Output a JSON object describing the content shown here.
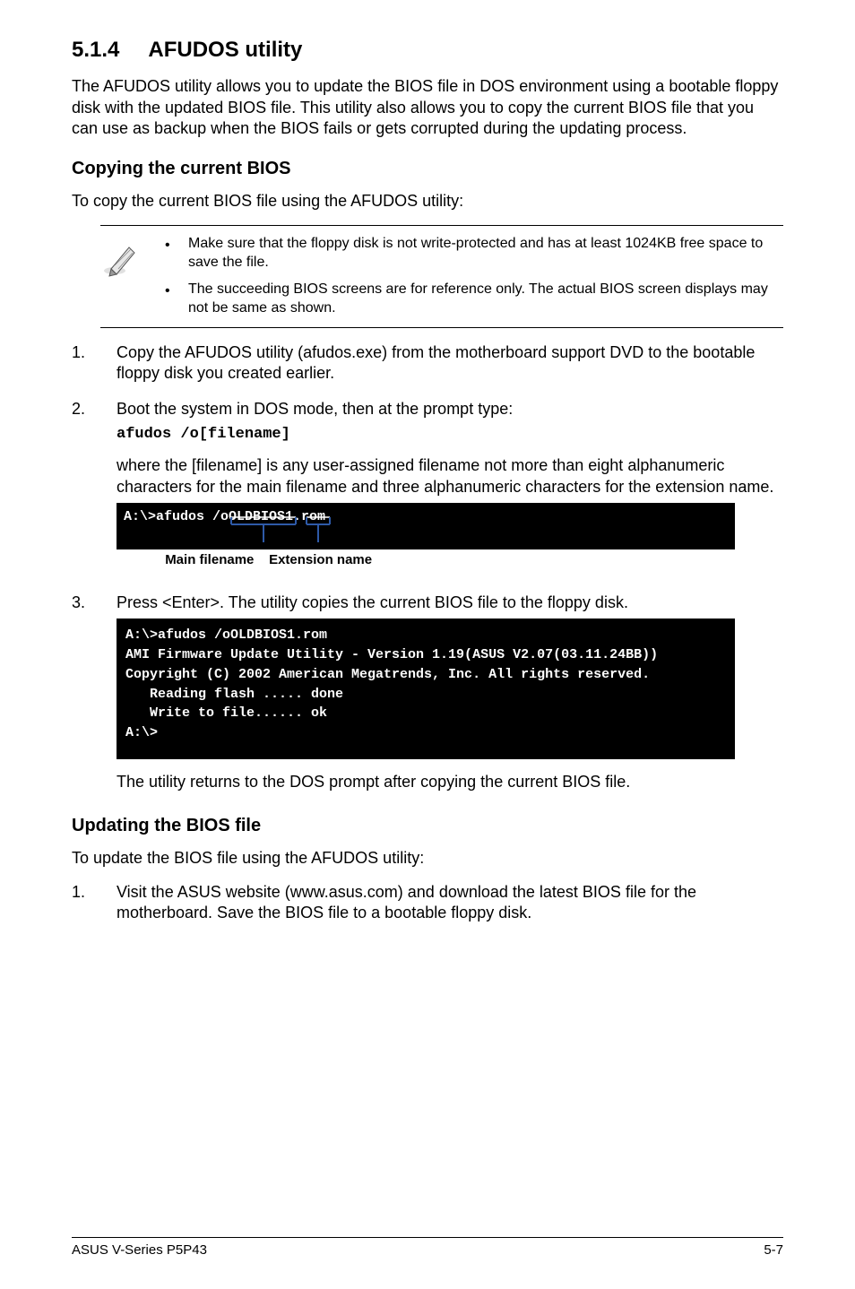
{
  "section": {
    "number": "5.1.4",
    "title": "AFUDOS utility"
  },
  "intro": "The AFUDOS utility allows you to update the BIOS file in DOS environment using a bootable floppy disk with the updated BIOS file. This utility also allows you to copy the current BIOS file that you can use as backup when the BIOS fails or gets corrupted during the updating process.",
  "copying": {
    "heading": "Copying the current BIOS",
    "lead": "To copy the current BIOS file using the AFUDOS utility:",
    "notes": [
      "Make sure that the floppy disk is not write-protected and has at least 1024KB free space to save the file.",
      "The succeeding BIOS screens are for reference only. The actual BIOS screen displays may not be same as shown."
    ]
  },
  "step1": "Copy the AFUDOS utility (afudos.exe) from the motherboard support DVD to the bootable floppy disk you created earlier.",
  "step2_lead": "Boot the system in DOS mode, then at the prompt type:",
  "step2_code": "afudos /o[filename]",
  "step2_desc": "where the [filename] is any user-assigned filename not more than eight alphanumeric characters  for the main filename and three alphanumeric characters for the extension name.",
  "term1_line": "A:\\>afudos /oOLDBIOS1.rom",
  "anno_main": "Main filename",
  "anno_ext": "Extension name",
  "step3": "Press <Enter>. The utility copies the current BIOS file to the floppy disk.",
  "term2": "A:\\>afudos /oOLDBIOS1.rom\nAMI Firmware Update Utility - Version 1.19(ASUS V2.07(03.11.24BB))\nCopyright (C) 2002 American Megatrends, Inc. All rights reserved.\n   Reading flash ..... done\n   Write to file...... ok\nA:\\>",
  "step3_tail": "The utility returns to the DOS prompt after copying the current BIOS file.",
  "updating": {
    "heading": "Updating the BIOS file",
    "lead": "To update the BIOS file using the AFUDOS utility:"
  },
  "upd_step1": "Visit the ASUS website (www.asus.com) and download the latest BIOS file for the motherboard. Save the BIOS file to a bootable floppy disk.",
  "footer": {
    "left": "ASUS V-Series P5P43",
    "right": "5-7"
  }
}
